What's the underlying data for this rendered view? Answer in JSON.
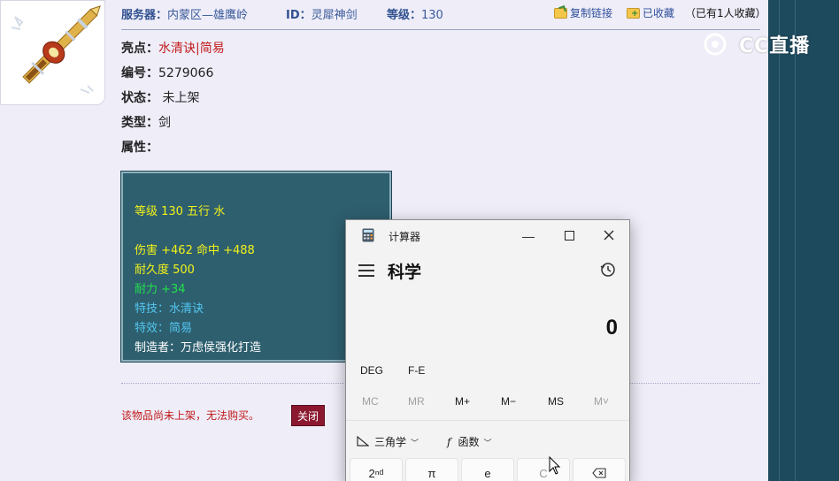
{
  "header": {
    "server_label": "服务器：",
    "server_value": "内蒙区—雄鹰岭",
    "id_label": "ID：",
    "id_value": "灵犀神剑",
    "level_label": "等级：",
    "level_value": "130",
    "copy_link": "复制链接",
    "favorited": "已收藏",
    "fav_count": "（已有1人收藏）"
  },
  "info": {
    "highlight_label": "亮点：",
    "highlight_value": "水清诀|简易",
    "number_label": "编号：",
    "number_value": "5279066",
    "status_label": "状态：",
    "status_value": "未上架",
    "type_label": "类型：",
    "type_value": "剑",
    "attr_label": "属性："
  },
  "stats": {
    "line1": "等级 130 五行 水",
    "line2": "伤害 +462 命中 +488",
    "line3": "耐久度 500",
    "line4": "耐力 +34",
    "line5": "特技：水清诀",
    "line6": "特效：简易",
    "line7": "制造者：万虑侯强化打造"
  },
  "footer": {
    "not_listed_msg": "该物品尚未上架，无法购买。",
    "close_label": "关闭"
  },
  "watermark": "CC直播",
  "calculator": {
    "title": "计算器",
    "mode": "科学",
    "display": "0",
    "deg": "DEG",
    "fe": "F-E",
    "mem": [
      "MC",
      "MR",
      "M+",
      "M−",
      "MS",
      "M˅"
    ],
    "trig": "三角学",
    "func": "函数",
    "keys": [
      "2ⁿᵈ",
      "π",
      "e",
      "C",
      "⌫"
    ]
  },
  "colors": {
    "stat_bg": "#2e5f6f",
    "stat_yellow": "#f2f21a",
    "stat_green": "#22e04a",
    "stat_cyan": "#53c6f0",
    "alert_red": "#c21a1a",
    "close_btn": "#8c1830"
  }
}
